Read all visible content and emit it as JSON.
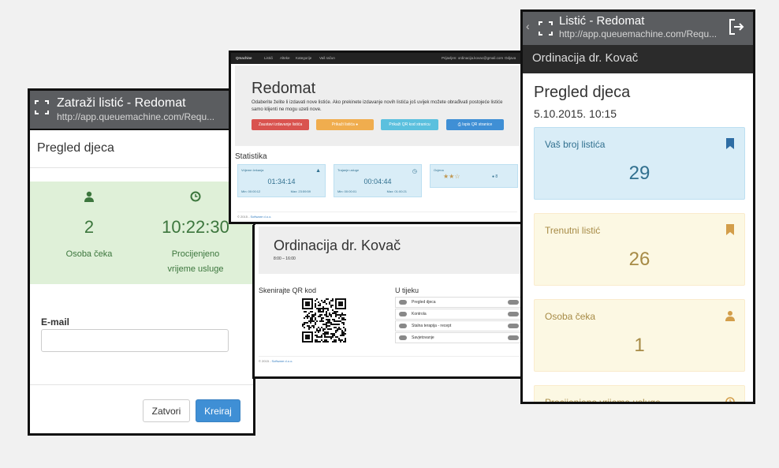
{
  "left_phone": {
    "window_title": "Zatraži listić - Redomat",
    "url": "http://app.queuemachine.com/Requ...",
    "page_title": "Pregled djeca",
    "stats": [
      {
        "value": "2",
        "label": "Osoba čeka"
      },
      {
        "value": "10:22:30",
        "label": "Procijenjeno vrijeme usluge"
      }
    ],
    "email_label": "E-mail",
    "email_value": "",
    "close_button": "Zatvori",
    "create_button": "Kreiraj"
  },
  "desktop_top": {
    "nav": {
      "brand": "Qmachine",
      "items": [
        "Listići",
        "Alteke",
        "Kategorije",
        "Vaš račun"
      ],
      "user": "Prijavljen: ordinacija.kovac@gmail.com",
      "logout": "Odjava"
    },
    "title": "Redomat",
    "description": "Odaberite želite li izdavati nove listiće. Ako prekinete izdavanje novih listića još uvijek možete obrađivati postojeće listiće samo klijenti ne mogu uzeti nove.",
    "buttons": [
      "Zaustavi izdavanje listića",
      "Prikaži listića",
      "Prikaži QR kod stranicu",
      "Ispis QR stranice"
    ],
    "stats_title": "Statistika",
    "cards": [
      {
        "label": "Vrijeme čekanja",
        "value": "01:34:14",
        "min": "Min: 00:00:12",
        "max": "Max: 23:59:59"
      },
      {
        "label": "Trajanje usluge",
        "value": "00:04:44",
        "min": "Min: 00:00:01",
        "max": "Max: 01:00:21"
      },
      {
        "label": "Ocjena",
        "value": "★★☆",
        "count": "8"
      }
    ],
    "footer_prefix": "© 2015 - ",
    "footer_link": "Software d.o.o."
  },
  "desktop_bottom": {
    "title": "Ordinacija dr. Kovač",
    "hours": "8:00 – 16:00",
    "qr_title": "Skenirajte QR kod",
    "progress_title": "U tijeku",
    "progress_items": [
      "Pregled djeca",
      "Kontrola",
      "Stalna terapija - recept",
      "Savjetovanje"
    ],
    "footer_prefix": "© 2015 - ",
    "footer_link": "Software d.o.o."
  },
  "right_phone": {
    "window_title": "Listić - Redomat",
    "url": "http://app.queuemachine.com/Requ...",
    "subheader": "Ordinacija dr. Kovač",
    "page_title": "Pregled djeca",
    "date": "5.10.2015. 10:15",
    "cards": [
      {
        "label": "Vaš broj listića",
        "value": "29"
      },
      {
        "label": "Trenutni listić",
        "value": "26"
      },
      {
        "label": "Osoba čeka",
        "value": "1"
      },
      {
        "label": "Procijenjeno vrijeme usluge",
        "value": ""
      }
    ]
  },
  "colors": {
    "success_bg": "#dff0d8",
    "success_text": "#3c763d",
    "info_bg": "#d9edf7",
    "info_text": "#31708f",
    "warning_bg": "#fcf8e3",
    "warning_text": "#a78b46",
    "primary": "#3f8fd5",
    "danger": "#d9534f",
    "orange": "#f0ad4e",
    "teal": "#5bc0de"
  }
}
